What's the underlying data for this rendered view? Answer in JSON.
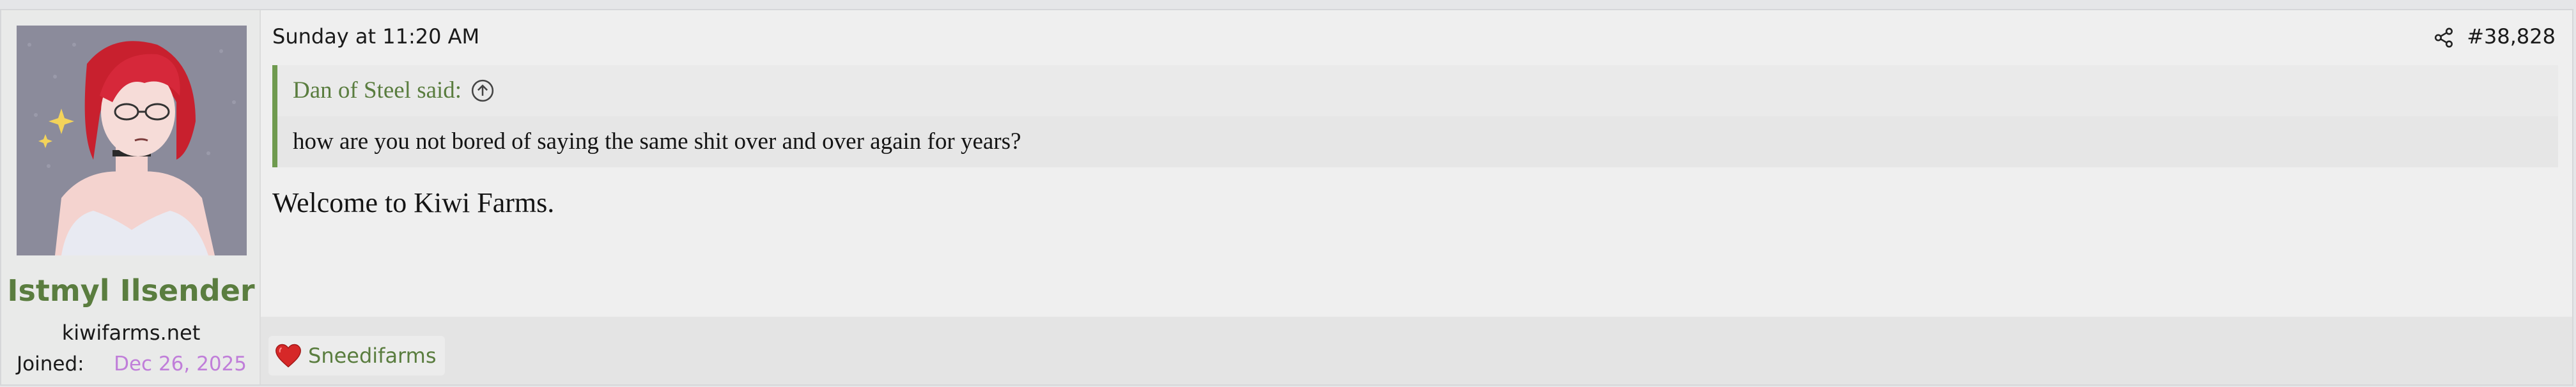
{
  "user": {
    "name": "Istmyl Ilsender",
    "title": "kiwifarms.net",
    "joined_label": "Joined:",
    "joined_date": "Dec 26, 2025"
  },
  "post": {
    "date": "Sunday at 11:20 AM",
    "number": "#38,828",
    "message": "Welcome to Kiwi Farms."
  },
  "quote": {
    "author": "Dan of Steel said:",
    "body": "how are you not bored of saying the same shit over and over again for years?"
  },
  "reactions": {
    "user": "Sneedifarms",
    "icon": "heart-icon"
  },
  "colors": {
    "accent_green": "#5a7d3f",
    "quote_border": "#6f9a4f",
    "joined_date": "#c07ed9",
    "heart": "#d62828"
  }
}
